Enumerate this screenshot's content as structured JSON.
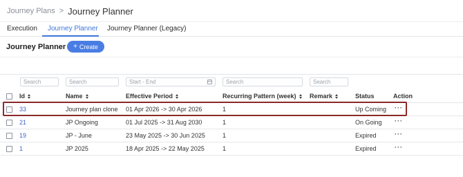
{
  "breadcrumb": {
    "parent": "Journey Plans",
    "separator": ">",
    "current": "Journey Planner"
  },
  "tabs": [
    {
      "label": "Execution"
    },
    {
      "label": "Journey Planner"
    },
    {
      "label": "Journey Planner (Legacy)"
    }
  ],
  "page": {
    "title": "Journey Planner",
    "create_label": "Create",
    "create_icon": "+"
  },
  "filters": {
    "id_placeholder": "Search",
    "name_placeholder": "Search",
    "period_placeholder": "Start - End",
    "recurring_placeholder": "Search",
    "remark_placeholder": "Search"
  },
  "columns": {
    "id": "Id",
    "name": "Name",
    "period": "Effective Period",
    "recurring": "Recurring Pattern (week)",
    "remark": "Remark",
    "status": "Status",
    "action": "Action"
  },
  "rows": [
    {
      "id": "33",
      "name": "Journey plan clone",
      "period": "01 Apr 2026 -> 30 Apr 2026",
      "recurring": "1",
      "remark": "",
      "status": "Up Coming",
      "action": "···"
    },
    {
      "id": "21",
      "name": "JP Ongoing",
      "period": "01 Jul 2025 -> 31 Aug 2030",
      "recurring": "1",
      "remark": "",
      "status": "On Going",
      "action": "···"
    },
    {
      "id": "19",
      "name": "JP - June",
      "period": "23 May 2025 -> 30 Jun 2025",
      "recurring": "1",
      "remark": "",
      "status": "Expired",
      "action": "···"
    },
    {
      "id": "1",
      "name": "JP 2025",
      "period": "18 Apr 2025 -> 22 May 2025",
      "recurring": "1",
      "remark": "",
      "status": "Expired",
      "action": "···"
    }
  ],
  "colors": {
    "accent": "#3e76d8",
    "button": "#4a7de3",
    "link": "#4263c6",
    "highlight": "#8a2a2a"
  }
}
